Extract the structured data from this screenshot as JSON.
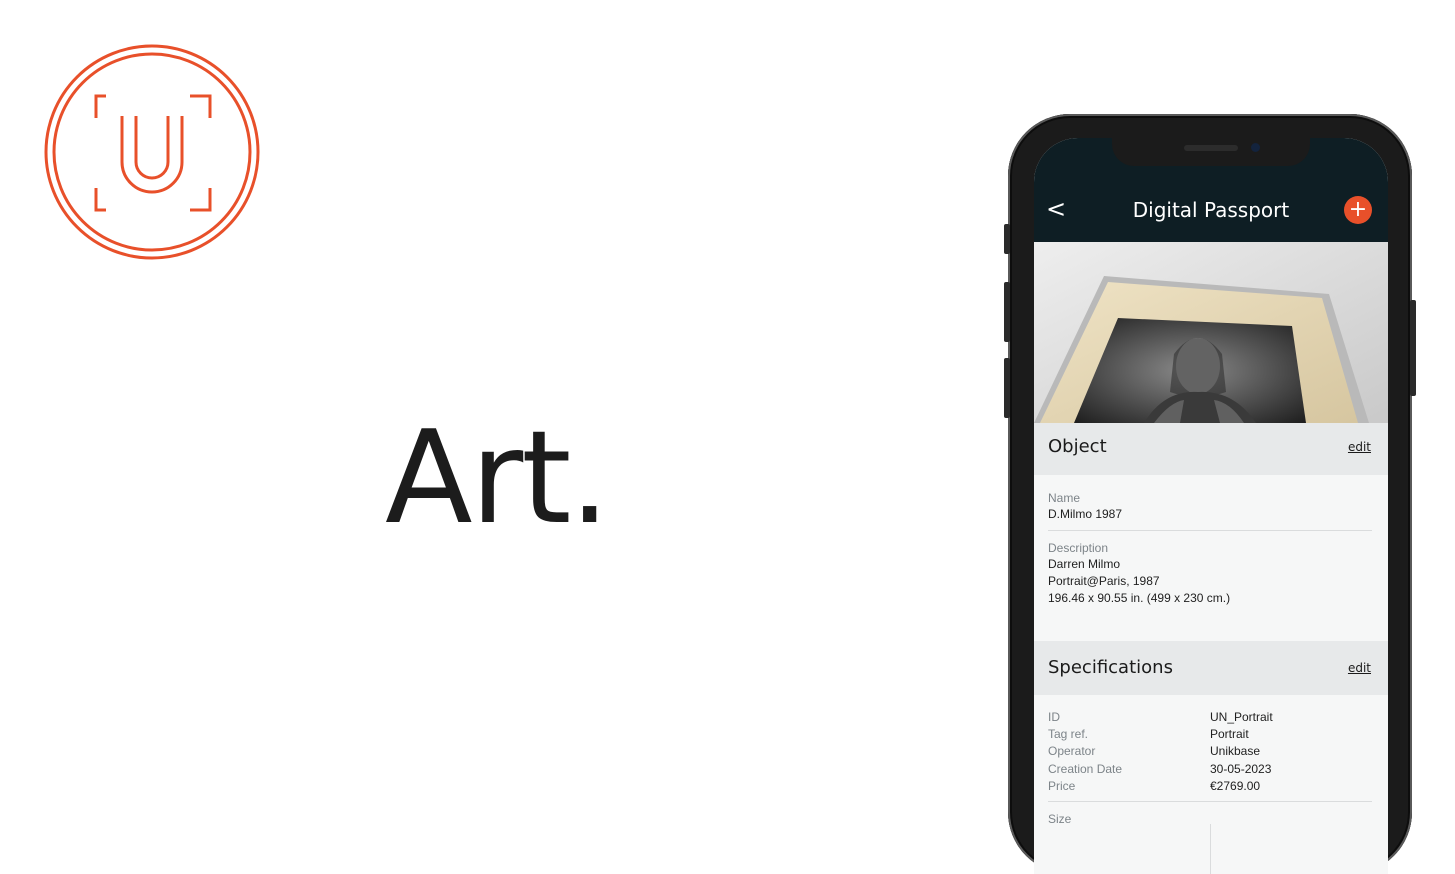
{
  "brand": {
    "accent_color": "#e8502a",
    "logo_icon": "unikbase-u-logo-icon"
  },
  "hero": {
    "text": "Art."
  },
  "app": {
    "title": "Digital Passport",
    "back_label": "<",
    "add_label": "+",
    "header_color": "#0e1e24",
    "photo_icon": "artwork-photo"
  },
  "object_section": {
    "title": "Object",
    "edit_label": "edit",
    "name_label": "Name",
    "name_value": "D.Milmo 1987",
    "description_label": "Description",
    "description_lines": [
      "Darren Milmo",
      "Portrait@Paris, 1987",
      "196.46 x 90.55 in. (499 x 230 cm.)"
    ]
  },
  "specifications_section": {
    "title": "Specifications",
    "edit_label": "edit",
    "rows": [
      {
        "label": "ID",
        "value": "UN_Portrait"
      },
      {
        "label": "Tag ref.",
        "value": "Portrait"
      },
      {
        "label": "Operator",
        "value": "Unikbase"
      },
      {
        "label": "Creation Date",
        "value": "30-05-2023"
      },
      {
        "label": "Price",
        "value": "€2769.00"
      }
    ],
    "size_label": "Size"
  }
}
